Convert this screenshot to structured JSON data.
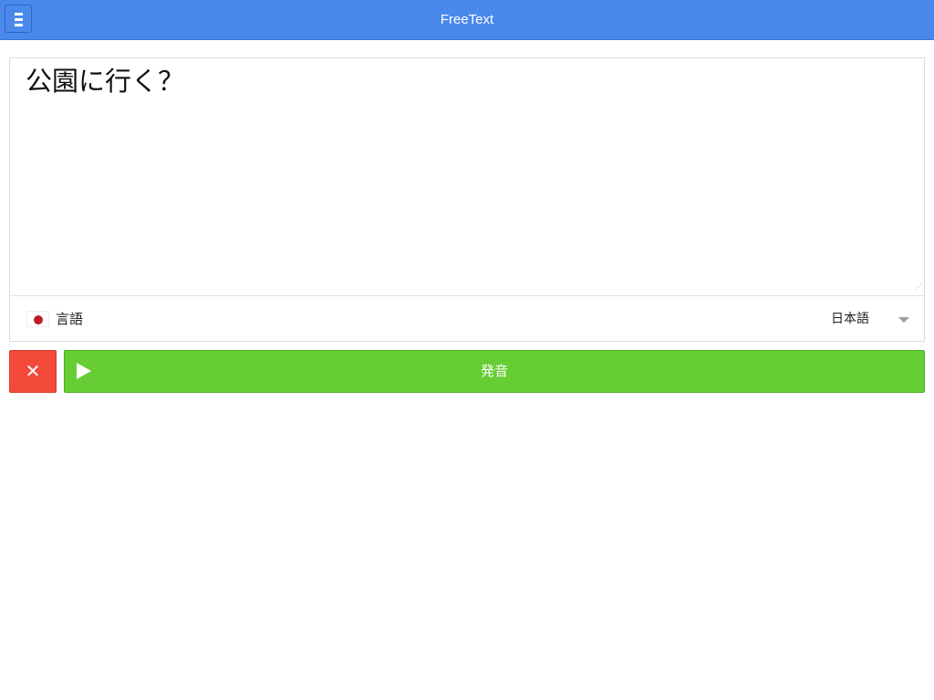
{
  "header": {
    "title": "FreeText",
    "menu_icon": "hamburger-icon",
    "background": "#4a89ec"
  },
  "editor": {
    "text": "公園に行く？",
    "resize_icon": "resize-grip-icon"
  },
  "language": {
    "flag_icon": "japan-flag-icon",
    "label": "言語",
    "selected": "日本語",
    "caret_icon": "chevron-down-icon"
  },
  "actions": {
    "clear_icon": "close-icon",
    "clear_symbol": "✕",
    "clear_color": "#f44a3a",
    "speak_icon": "play-icon",
    "speak_label": "発音",
    "speak_color": "#66cd35"
  }
}
